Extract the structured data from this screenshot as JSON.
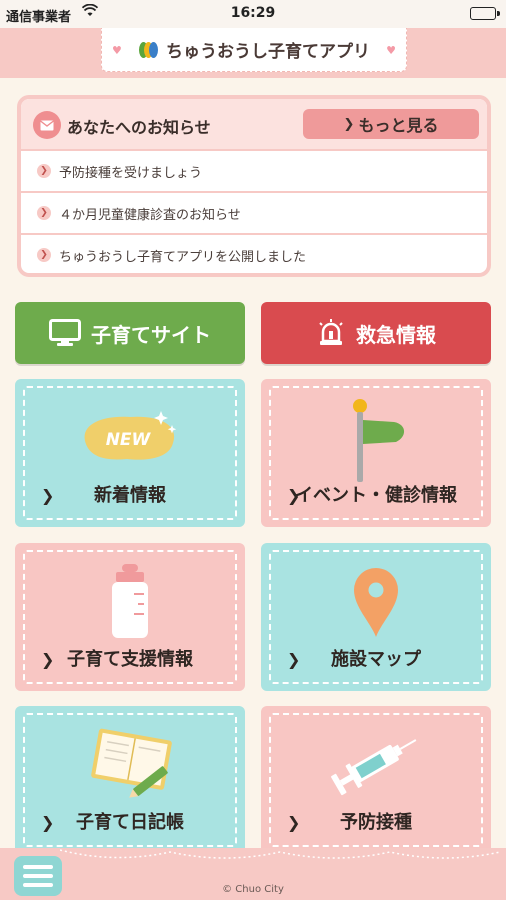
{
  "status_bar": {
    "carrier": "通信事業者",
    "time": "16:29"
  },
  "header": {
    "app_title": "ちゅうおうし子育てアプリ"
  },
  "notice": {
    "title": "あなたへのお知らせ",
    "more_label": "もっと見る",
    "items": [
      "予防接種を受けましょう",
      "４か月児童健康診査のお知らせ",
      "ちゅうおうし子育てアプリを公開しました"
    ]
  },
  "big_buttons": {
    "site_label": "子育てサイト",
    "emergency_label": "救急情報"
  },
  "tiles": [
    {
      "label": "新着情報",
      "icon": "new-badge-icon"
    },
    {
      "label": "イベント・健診情報",
      "icon": "flag-icon"
    },
    {
      "label": "子育て支援情報",
      "icon": "baby-bottle-icon"
    },
    {
      "label": "施設マップ",
      "icon": "map-pin-icon"
    },
    {
      "label": "子育て日記帳",
      "icon": "diary-icon"
    },
    {
      "label": "予防接種",
      "icon": "syringe-icon"
    }
  ],
  "new_badge_text": "NEW",
  "footer": {
    "copyright": "© Chuo City"
  },
  "colors": {
    "header_pink": "#f7c9c5",
    "teal_tile": "#a9e3e1",
    "pink_tile": "#f8c6c3",
    "site_green": "#6eab4c",
    "emergency_red": "#d94b4f"
  }
}
